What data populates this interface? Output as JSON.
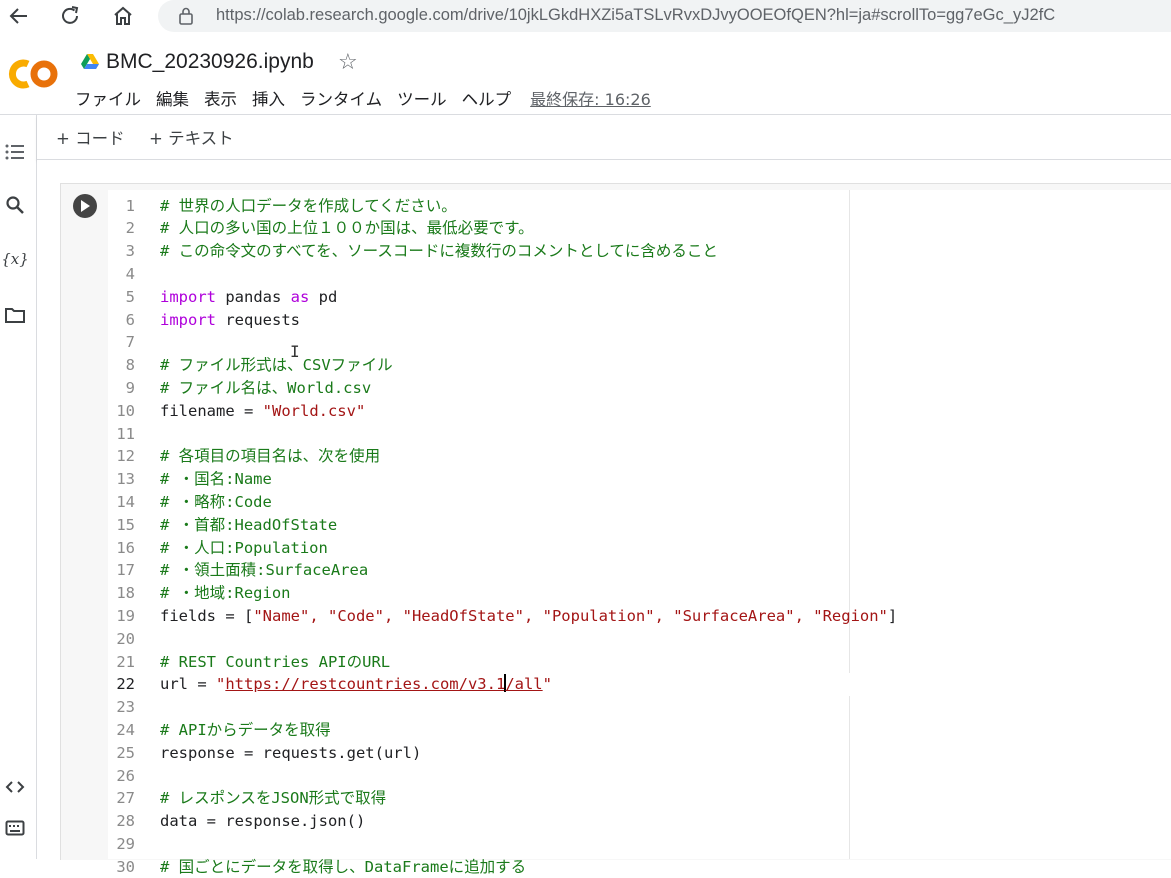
{
  "browser": {
    "url": "https://colab.research.google.com/drive/10jkLGkdHXZi5aTSLvRvxDJvyOOEOfQEN?hl=ja#scrollTo=gg7eGc_yJ2fC"
  },
  "header": {
    "logo_text": "CO",
    "title": "BMC_20230926.ipynb",
    "menu": [
      "ファイル",
      "編集",
      "表示",
      "挿入",
      "ランタイム",
      "ツール",
      "ヘルプ"
    ],
    "last_saved": "最終保存: 16:26"
  },
  "toolbar": {
    "add_code": "+ コード",
    "add_text": "+ テキスト"
  },
  "rail": {
    "icons": [
      "toc-icon",
      "search-icon",
      "variables-icon",
      "folder-icon",
      "code-snippets-icon",
      "terminal-icon"
    ],
    "variables_label": "{x}"
  },
  "editor": {
    "active_line": 22,
    "lines": [
      {
        "n": "1",
        "t": "# 世界の人口データを作成してください。"
      },
      {
        "n": "2",
        "t": "# 人口の多い国の上位１００か国は、最低必要です。"
      },
      {
        "n": "3",
        "t": "# この命令文のすべてを、ソースコードに複数行のコメントとしてに含めること"
      },
      {
        "n": "4",
        "t": ""
      },
      {
        "n": "5",
        "kw": "import",
        "t": " pandas ",
        "kw2": "as",
        "t2": " pd"
      },
      {
        "n": "6",
        "kw": "import",
        "t": " requests"
      },
      {
        "n": "7",
        "t": ""
      },
      {
        "n": "8",
        "t": "# ファイル形式は、CSVファイル"
      },
      {
        "n": "9",
        "t": "# ファイル名は、World.csv"
      },
      {
        "n": "10",
        "t": "filename = ",
        "s": "\"World.csv\""
      },
      {
        "n": "11",
        "t": ""
      },
      {
        "n": "12",
        "t": "# 各項目の項目名は、次を使用"
      },
      {
        "n": "13",
        "t": "# ・国名:Name"
      },
      {
        "n": "14",
        "t": "# ・略称:Code"
      },
      {
        "n": "15",
        "t": "# ・首都:HeadOfState"
      },
      {
        "n": "16",
        "t": "# ・人口:Population"
      },
      {
        "n": "17",
        "t": "# ・領土面積:SurfaceArea"
      },
      {
        "n": "18",
        "t": "# ・地域:Region"
      },
      {
        "n": "19",
        "t": "fields = [",
        "s": "\"Name\", \"Code\", \"HeadOfState\", \"Population\", \"SurfaceArea\", \"Region\"",
        "t2": "]"
      },
      {
        "n": "20",
        "t": ""
      },
      {
        "n": "21",
        "t": "# REST Countries APIのURL"
      },
      {
        "n": "22",
        "t": "url = ",
        "s": "\"",
        "u1": "https://restcountries.com/v3.1",
        "u2": "/all",
        "s2": "\""
      },
      {
        "n": "23",
        "t": ""
      },
      {
        "n": "24",
        "t": "# APIからデータを取得"
      },
      {
        "n": "25",
        "t": "response = requests.get(url)"
      },
      {
        "n": "26",
        "t": ""
      },
      {
        "n": "27",
        "t": "# レスポンスをJSON形式で取得"
      },
      {
        "n": "28",
        "t": "data = response.json()"
      },
      {
        "n": "29",
        "t": ""
      },
      {
        "n": "30",
        "t": "# 国ごとにデータを取得し、DataFrameに追加する"
      }
    ]
  }
}
